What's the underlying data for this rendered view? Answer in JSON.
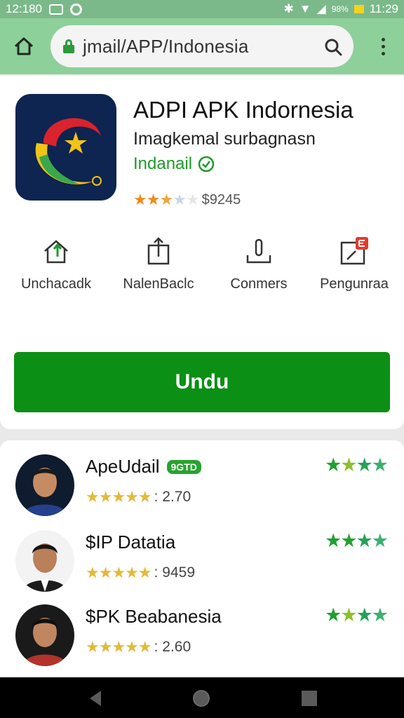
{
  "status_bar": {
    "time_left": "12:180",
    "battery_pct": "98%",
    "time_right": "11:29"
  },
  "browser": {
    "url": "jmail/APP/Indonesia"
  },
  "app": {
    "title": "ADPI APK Indornesia",
    "subtitle": "Imagkemal surbagnasn",
    "developer": "Indanail",
    "rating_stars": "★★★★★",
    "rating_text": "$9245"
  },
  "actions": [
    {
      "label": "Unchacadk",
      "icon": "upload-home-icon"
    },
    {
      "label": "NalenBaclc",
      "icon": "share-icon"
    },
    {
      "label": "Conmers",
      "icon": "download-icon"
    },
    {
      "label": "Pengunraa",
      "icon": "badge-icon"
    }
  ],
  "install_button": "Undu",
  "reviews": [
    {
      "name": "ApeUdail",
      "badge": "9GTD",
      "stars": "★★★★★",
      "score": ": 2.70",
      "right_stars": "★★★★"
    },
    {
      "name": "$IP Datatia",
      "badge": "",
      "stars": "★★★★★",
      "score": ": 9459",
      "right_stars": "★★★★"
    },
    {
      "name": "$PK Beabanesia",
      "badge": "",
      "stars": "★★★★★",
      "score": ": 2.60",
      "right_stars": "★★★★"
    }
  ],
  "colors": {
    "brand_green": "#0b8f15",
    "status_bar": "#7cb98a",
    "browser_bar": "#8ed09a",
    "star_orange": "#f08a1c",
    "star_gold": "#e3b93a",
    "star_green": "#27a32f"
  }
}
